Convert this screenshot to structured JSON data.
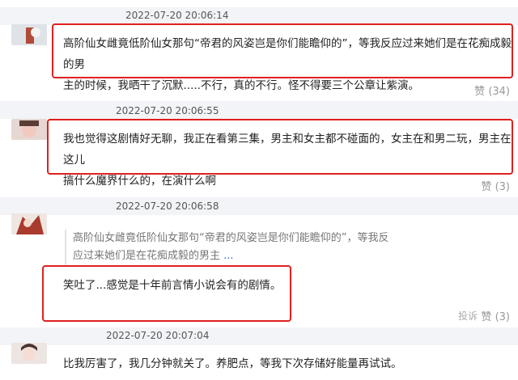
{
  "comments": [
    {
      "timestamp": "2022-07-20 20:06:14",
      "avatar": "avatar-image",
      "text_line1": "高阶仙女雌竟低阶仙女那句“帝君的风姿岂是你们能瞻仰的”，等我反应过来她们是在花痴成毅的男",
      "text_line2": "主的时候，我晒干了沉默.....不行，真的不行。怪不得要三个公章让紫演。",
      "like_label": "赞",
      "like_count": "(34)"
    },
    {
      "timestamp": "2022-07-20 20:06:55",
      "avatar": "avatar-image",
      "text_line1": "我也觉得这剧情好无聊，我正在看第三集，男主和女主都不碰面的，女主在和男二玩，男主在这儿",
      "text_line2": "搞什么魔界什么的，在演什么啊",
      "like_label": "赞",
      "like_count": "(3)"
    },
    {
      "timestamp": "2022-07-20 20:06:58",
      "avatar": "avatar-image",
      "quote_line1": "高阶仙女雌竟低阶仙女那句“帝君的风姿岂是你们能瞻仰的”，等我反",
      "quote_line2": "应过来她们是在花痴成毅的男主",
      "quote_more": "...",
      "text_line1": "笑吐了...感觉是十年前言情小说会有的剧情。",
      "report_label": "投诉",
      "like_label": "赞",
      "like_count": "(3)"
    },
    {
      "timestamp": "2022-07-20 20:07:04",
      "avatar": "avatar-image",
      "text_line1": "比我厉害了，我几分钟就关了。养肥点，等我下次存储好能量再试试。"
    }
  ],
  "colors": {
    "highlight": "#e02020",
    "header_band": "#f2f4f7",
    "link": "#3a72c8"
  }
}
